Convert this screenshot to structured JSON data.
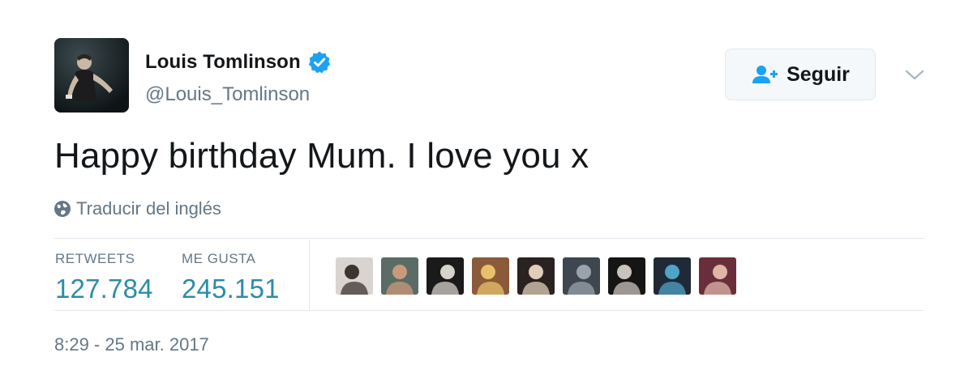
{
  "user": {
    "display_name": "Louis Tomlinson",
    "handle": "@Louis_Tomlinson",
    "verified": true,
    "avatar_icon": "avatar-photo"
  },
  "follow": {
    "label": "Seguir",
    "icon": "follow-user-icon"
  },
  "menu": {
    "icon": "chevron-down-icon"
  },
  "tweet": {
    "text": "Happy birthday Mum. I love you x",
    "translate_label": "Traducir del inglés",
    "translate_icon": "globe-icon"
  },
  "stats": {
    "retweets_label": "RETWEETS",
    "retweets_value": "127.784",
    "likes_label": "ME GUSTA",
    "likes_value": "245.151"
  },
  "likers": [
    {
      "name": "liker-avatar-1",
      "colors": [
        "#d9d4cf",
        "#3b3431"
      ]
    },
    {
      "name": "liker-avatar-2",
      "colors": [
        "#5b6b66",
        "#c89a7a"
      ]
    },
    {
      "name": "liker-avatar-3",
      "colors": [
        "#1a1a1a",
        "#d6d2cc"
      ]
    },
    {
      "name": "liker-avatar-4",
      "colors": [
        "#8a5a3a",
        "#e8c06a"
      ]
    },
    {
      "name": "liker-avatar-5",
      "colors": [
        "#2a2220",
        "#e1cdb8"
      ]
    },
    {
      "name": "liker-avatar-6",
      "colors": [
        "#3e4650",
        "#9aa3ab"
      ]
    },
    {
      "name": "liker-avatar-7",
      "colors": [
        "#151515",
        "#c9c3bd"
      ]
    },
    {
      "name": "liker-avatar-8",
      "colors": [
        "#1f2a36",
        "#4fa3c7"
      ]
    },
    {
      "name": "liker-avatar-9",
      "colors": [
        "#6a2e3a",
        "#e0b5a8"
      ]
    }
  ],
  "timestamp": "8:29 - 25 mar. 2017",
  "colors": {
    "verified_blue": "#1da1f2",
    "count_blue": "#2c8ca8",
    "muted_gray": "#657786",
    "text_dark": "#14171a"
  }
}
